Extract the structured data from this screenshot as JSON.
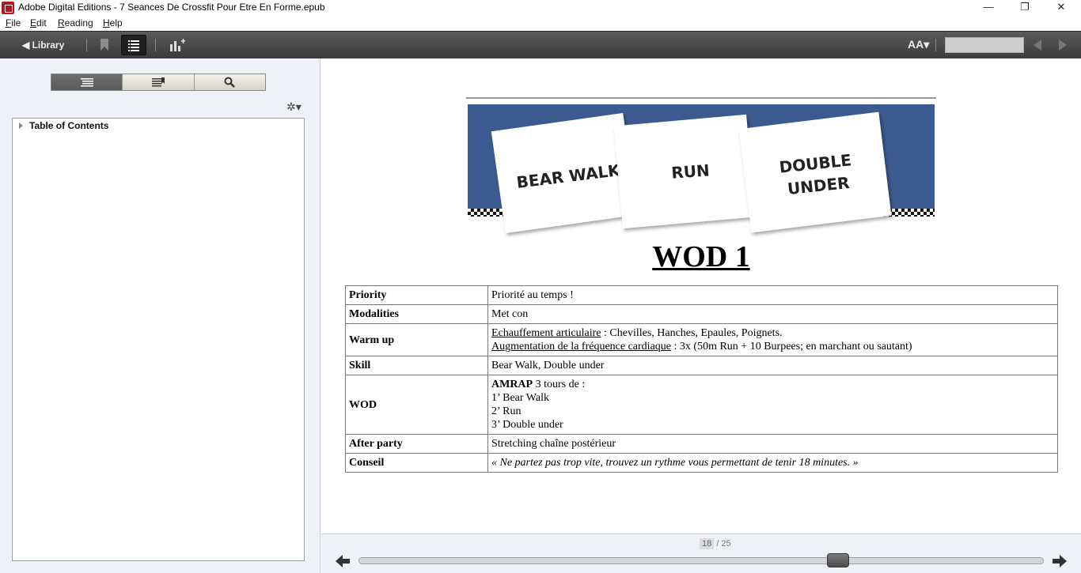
{
  "window": {
    "title": "Adobe Digital Editions - 7 Seances De Crossfit Pour Etre En Forme.epub",
    "minimize_glyph": "—",
    "restore_glyph": "❐",
    "close_glyph": "✕"
  },
  "menu": {
    "file": {
      "u": "F",
      "rest": "ile"
    },
    "edit": {
      "u": "E",
      "rest": "dit"
    },
    "reading": {
      "u": "R",
      "rest": "eading"
    },
    "help": {
      "u": "H",
      "rest": "elp"
    }
  },
  "toolbar": {
    "library_label": "◀ Library",
    "font_size_label": "AA▾"
  },
  "sidebar": {
    "toc_label": "Table of Contents",
    "gear_glyph": "✲▾"
  },
  "banner": {
    "cards": [
      "BEAR WALK",
      "RUN",
      "DOUBLE UNDER"
    ],
    "card_lines": {
      "card3_line1": "DOUBLE",
      "card3_line2": "UNDER"
    },
    "background_color": "#3b5a8f"
  },
  "content": {
    "title": "WOD 1",
    "rows": {
      "priority": {
        "key": "Priority",
        "value": "Priorité au temps !"
      },
      "modalities": {
        "key": "Modalities",
        "value": "Met con"
      },
      "warmup": {
        "key": "Warm up",
        "line1_link": "Echauffement articulaire",
        "line1_rest": " : Chevilles, Hanches, Epaules, Poignets.",
        "line2_link": "Augmentation de la fréquence cardiaque",
        "line2_rest": " : 3x (50m Run + 10 Burpees; en marchant ou sautant)"
      },
      "skill": {
        "key": "Skill",
        "value": "Bear Walk, Double under"
      },
      "wod": {
        "key": "WOD",
        "bold": "AMRAP",
        "line1_rest": " 3 tours de :",
        "line2": "1’ Bear Walk",
        "line3": "2’ Run",
        "line4": "3’ Double under"
      },
      "after_party": {
        "key": "After party",
        "value": "Stretching chaîne postérieur"
      },
      "conseil": {
        "key": "Conseil",
        "value": "« Ne partez pas trop vite, trouvez un rythme vous permettant de tenir 18 minutes. »"
      }
    }
  },
  "pagination": {
    "current": "18",
    "total_label": "/ 25",
    "progress": 0.7
  }
}
